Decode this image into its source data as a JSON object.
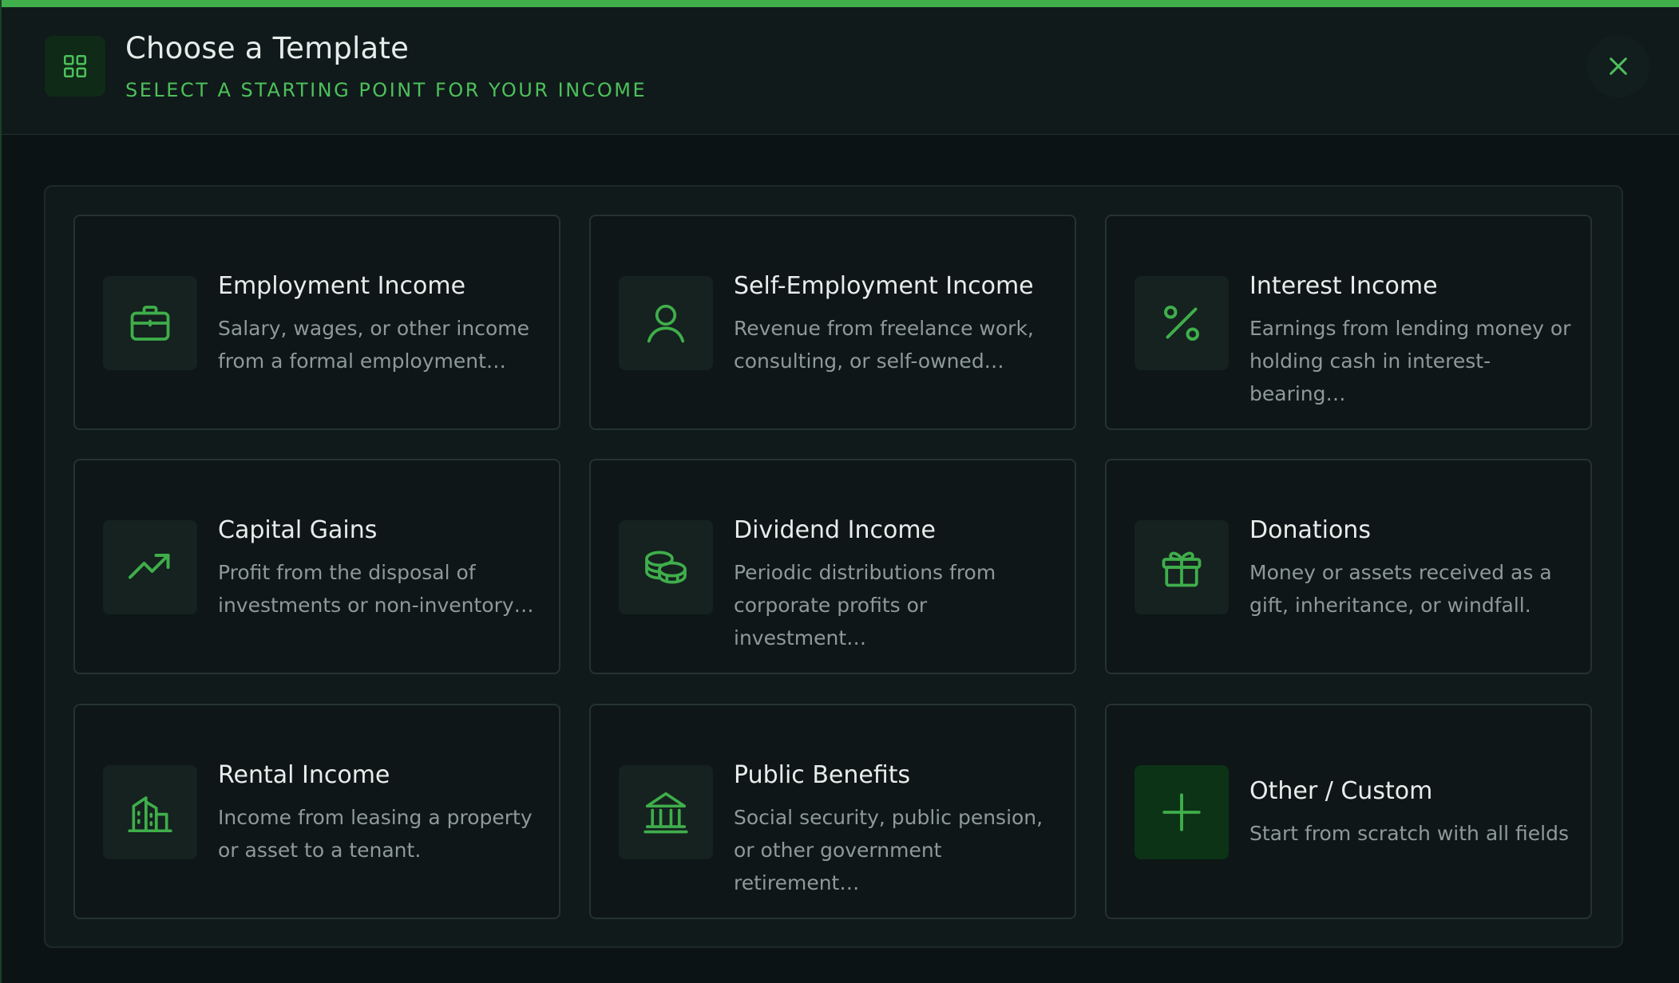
{
  "header": {
    "title": "Choose a Template",
    "subtitle": "SELECT A STARTING POINT FOR YOUR INCOME",
    "icon": "grid-icon",
    "close_icon": "close-icon"
  },
  "colors": {
    "accent": "#3fae4b",
    "accent_text": "#4dc05b",
    "background": "#0f1718"
  },
  "templates": [
    {
      "title": "Employment Income",
      "description": "Salary, wages, or other income from a formal employment…",
      "icon": "briefcase-icon"
    },
    {
      "title": "Self-Employment Income",
      "description": "Revenue from freelance work, consulting, or self-owned…",
      "icon": "user-icon"
    },
    {
      "title": "Interest Income",
      "description": "Earnings from lending money or holding cash in interest-bearing…",
      "icon": "percent-icon"
    },
    {
      "title": "Capital Gains",
      "description": "Profit from the disposal of investments or non-inventory…",
      "icon": "trending-up-icon"
    },
    {
      "title": "Dividend Income",
      "description": "Periodic distributions from corporate profits or investment…",
      "icon": "coins-icon"
    },
    {
      "title": "Donations",
      "description": "Money or assets received as a gift, inheritance, or windfall.",
      "icon": "gift-icon"
    },
    {
      "title": "Rental Income",
      "description": "Income from leasing a property or asset to a tenant.",
      "icon": "building-icon"
    },
    {
      "title": "Public Benefits",
      "description": "Social security, public pension, or other government retirement…",
      "icon": "bank-icon"
    },
    {
      "title": "Other / Custom",
      "description": "Start from scratch with all fields",
      "icon": "plus-icon"
    }
  ]
}
